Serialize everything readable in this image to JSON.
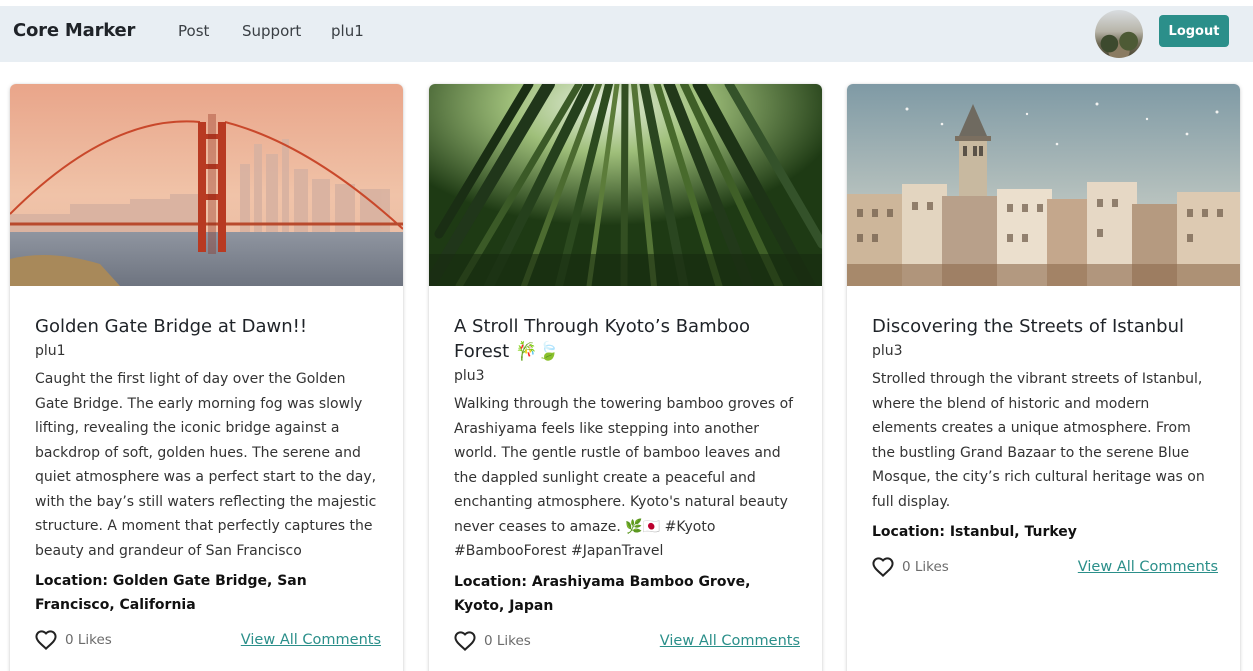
{
  "navbar": {
    "brand": "Core Marker",
    "links": [
      "Post",
      "Support",
      "plu1"
    ],
    "logout_label": "Logout"
  },
  "colors": {
    "navbar_bg": "#e8eef3",
    "accent": "#2b8f8a"
  },
  "posts": [
    {
      "title": "Golden Gate Bridge at Dawn!!",
      "author": "plu1",
      "description": "Caught the first light of day over the Golden Gate Bridge. The early morning fog was slowly lifting, revealing the iconic bridge against a backdrop of soft, golden hues. The serene and quiet atmosphere was a perfect start to the day, with the bay’s still waters reflecting the majestic structure. A moment that perfectly captures the beauty and grandeur of San Francisco",
      "location": "Location: Golden Gate Bridge, San Francisco, California",
      "likes": "0 Likes",
      "comments_label": "View All Comments",
      "image_icon": "golden-gate-bridge-photo"
    },
    {
      "title": "A Stroll Through Kyoto’s Bamboo Forest 🎋🍃",
      "author": "plu3",
      "description": "Walking through the towering bamboo groves of Arashiyama feels like stepping into another world. The gentle rustle of bamboo leaves and the dappled sunlight create a peaceful and enchanting atmosphere. Kyoto's natural beauty never ceases to amaze. 🌿🇯🇵 #Kyoto #BambooForest #JapanTravel",
      "location": "Location: Arashiyama Bamboo Grove, Kyoto, Japan",
      "likes": "0 Likes",
      "comments_label": "View All Comments",
      "image_icon": "bamboo-forest-photo"
    },
    {
      "title": "Discovering the Streets of Istanbul",
      "author": "plu3",
      "description": "Strolled through the vibrant streets of Istanbul, where the blend of historic and modern elements creates a unique atmosphere. From the bustling Grand Bazaar to the serene Blue Mosque, the city’s rich cultural heritage was on full display.",
      "location": "Location: Istanbul, Turkey",
      "likes": "0 Likes",
      "comments_label": "View All Comments",
      "image_icon": "istanbul-galata-tower-photo"
    }
  ]
}
